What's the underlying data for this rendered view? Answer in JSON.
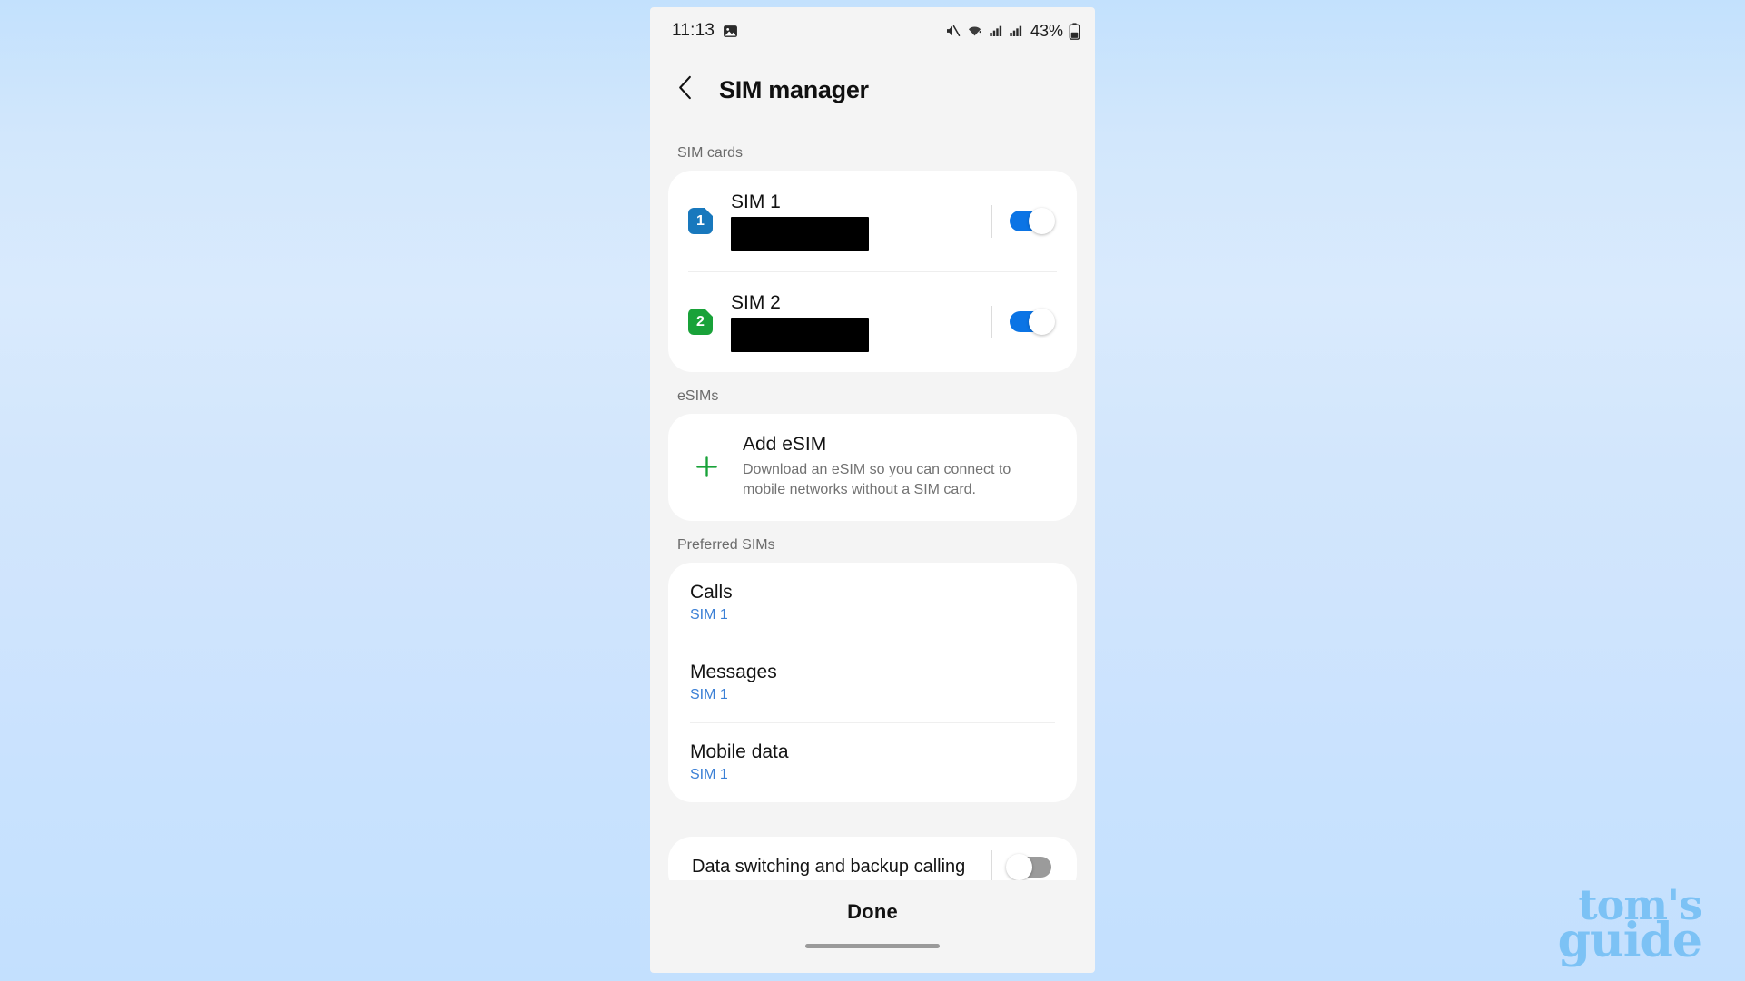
{
  "status_bar": {
    "time": "11:13",
    "battery_percent": "43%",
    "icons": [
      "image-icon",
      "mute-icon",
      "wifi-icon",
      "signal-1-icon",
      "signal-2-icon",
      "battery-icon"
    ]
  },
  "header": {
    "title": "SIM manager",
    "back_icon": "chevron-left-icon"
  },
  "sections": {
    "sim_cards_label": "SIM cards",
    "esims_label": "eSIMs",
    "preferred_sims_label": "Preferred SIMs"
  },
  "sim_cards": [
    {
      "badge": "1",
      "badge_color": "#1878bd",
      "name": "SIM 1",
      "number": "",
      "redacted": true,
      "enabled": true
    },
    {
      "badge": "2",
      "badge_color": "#19a239",
      "name": "SIM 2",
      "number": "",
      "redacted": true,
      "enabled": true
    }
  ],
  "esim": {
    "title": "Add eSIM",
    "description": "Download an eSIM so you can connect to mobile networks without a SIM card.",
    "plus_icon_color": "#19a239"
  },
  "preferred_sims": [
    {
      "title": "Calls",
      "value": "SIM 1"
    },
    {
      "title": "Messages",
      "value": "SIM 1"
    },
    {
      "title": "Mobile data",
      "value": "SIM 1"
    }
  ],
  "data_switching": {
    "label": "Data switching and backup calling",
    "enabled": false
  },
  "footer": {
    "done_label": "Done"
  },
  "watermark": {
    "line1": "tom's",
    "line2": "guide",
    "color": "#7cc2f5"
  },
  "colors": {
    "accent_blue": "#0b74e5",
    "link_blue": "#3a7fd5",
    "green": "#19a239",
    "toggle_off_gray": "#9b9b9b",
    "card_bg": "#ffffff",
    "screen_bg": "#f4f4f4"
  }
}
